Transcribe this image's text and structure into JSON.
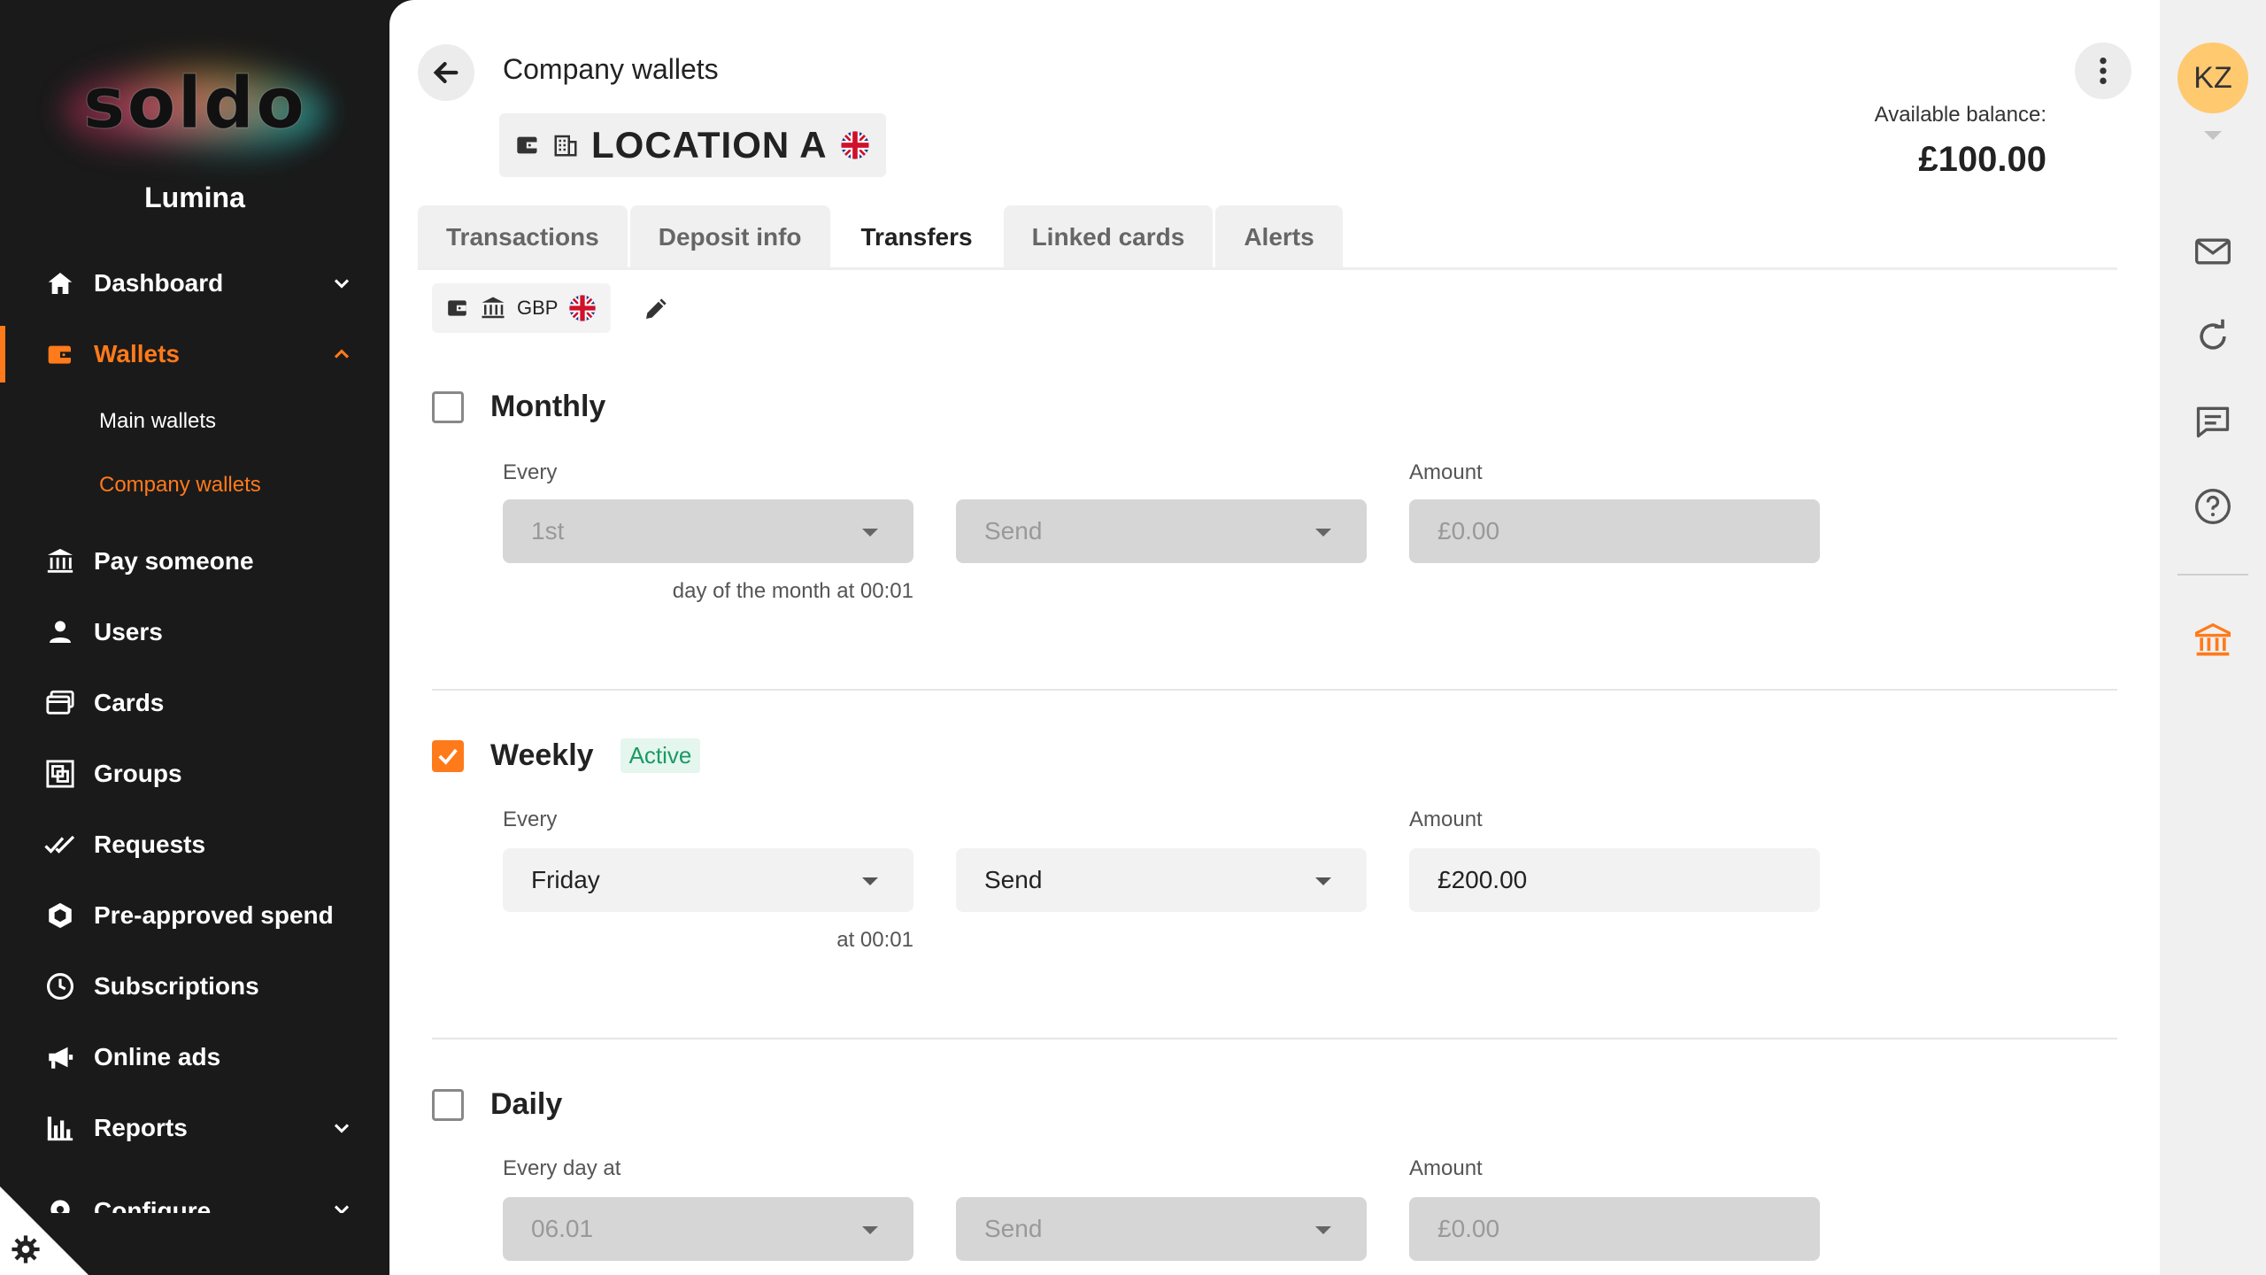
{
  "brand": {
    "logo_text": "soldo",
    "org_name": "Lumina"
  },
  "sidebar": {
    "items": [
      {
        "label": "Dashboard",
        "icon": "home-icon",
        "has_chevron": "down"
      },
      {
        "label": "Wallets",
        "icon": "wallet-icon",
        "has_chevron": "up",
        "active": true
      },
      {
        "label": "Pay someone",
        "icon": "bank-transfer-icon"
      },
      {
        "label": "Users",
        "icon": "user-icon"
      },
      {
        "label": "Cards",
        "icon": "cards-icon"
      },
      {
        "label": "Groups",
        "icon": "groups-icon"
      },
      {
        "label": "Requests",
        "icon": "double-check-icon"
      },
      {
        "label": "Pre-approved spend",
        "icon": "hexagon-icon"
      },
      {
        "label": "Subscriptions",
        "icon": "clock-icon"
      },
      {
        "label": "Online ads",
        "icon": "megaphone-icon"
      },
      {
        "label": "Reports",
        "icon": "bar-chart-icon",
        "has_chevron": "down"
      },
      {
        "label": "Configure",
        "icon": "cog-icon",
        "has_chevron": "down"
      }
    ],
    "wallets_sub": [
      {
        "label": "Main wallets"
      },
      {
        "label": "Company wallets",
        "active": true
      }
    ]
  },
  "header": {
    "breadcrumb": "Company wallets",
    "location_name": "LOCATION A",
    "balance_label": "Available balance:",
    "balance_value": "£100.00"
  },
  "tabs": [
    {
      "label": "Transactions"
    },
    {
      "label": "Deposit info"
    },
    {
      "label": "Transfers",
      "active": true
    },
    {
      "label": "Linked cards"
    },
    {
      "label": "Alerts"
    }
  ],
  "wallet_chip": {
    "currency": "GBP"
  },
  "transfers": {
    "monthly": {
      "title": "Monthly",
      "checked": false,
      "every_label": "Every",
      "every_value": "1st",
      "action_value": "Send",
      "amount_label": "Amount",
      "amount_value": "£0.00",
      "hint": "day of the month at 00:01"
    },
    "weekly": {
      "title": "Weekly",
      "checked": true,
      "badge": "Active",
      "every_label": "Every",
      "every_value": "Friday",
      "action_value": "Send",
      "amount_label": "Amount",
      "amount_value": "£200.00",
      "hint": "at 00:01"
    },
    "daily": {
      "title": "Daily",
      "checked": false,
      "every_label": "Every day at",
      "every_value": "06.01",
      "action_value": "Send",
      "amount_label": "Amount",
      "amount_value": "£0.00"
    }
  },
  "rail": {
    "avatar_initials": "KZ",
    "icons": [
      "mail-icon",
      "refresh-icon",
      "chat-icon",
      "help-icon",
      "bank-icon"
    ]
  },
  "colors": {
    "accent": "#ff7a1a",
    "sidebar_bg": "#1a1a1a",
    "active_badge_bg": "#e4f6ee",
    "active_badge_text": "#1b9a64",
    "avatar_bg": "#ffc970"
  }
}
